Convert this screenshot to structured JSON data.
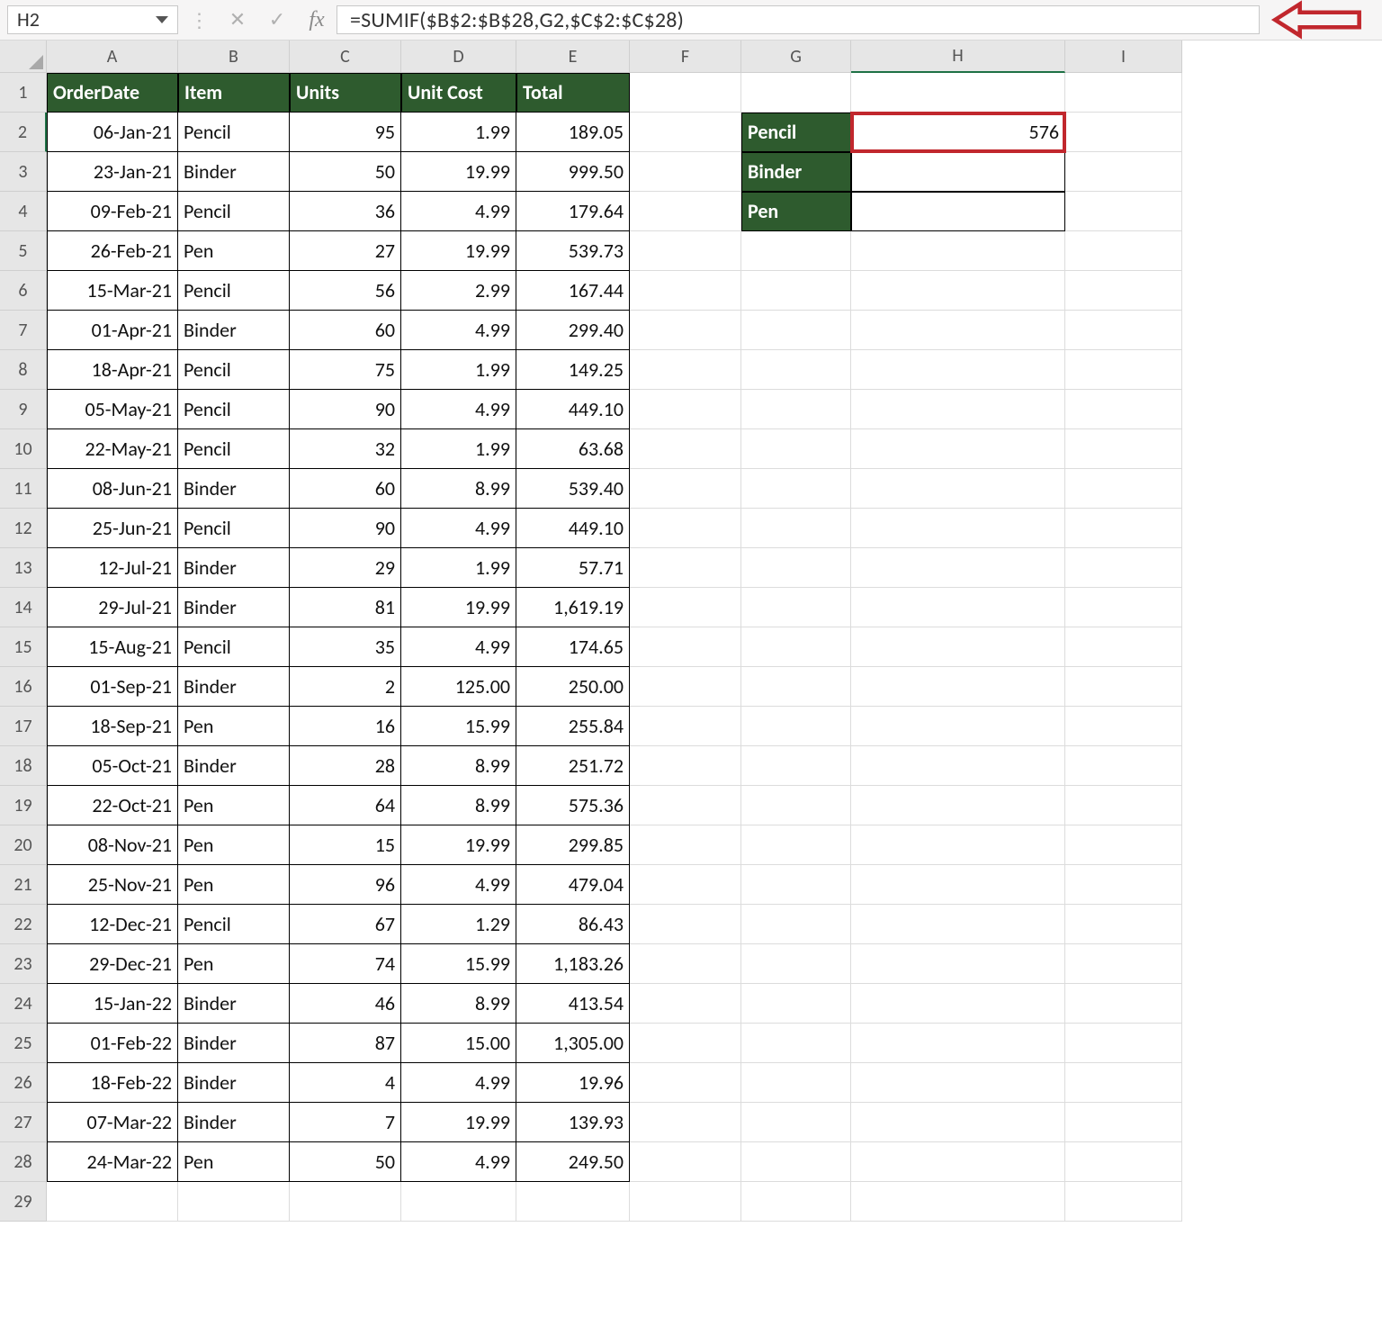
{
  "namebox": "H2",
  "formula": "=SUMIF($B$2:$B$28,G2,$C$2:$C$28)",
  "fx_label": "fx",
  "col_labels": [
    "A",
    "B",
    "C",
    "D",
    "E",
    "F",
    "G",
    "H",
    "I"
  ],
  "row_labels": [
    "1",
    "2",
    "3",
    "4",
    "5",
    "6",
    "7",
    "8",
    "9",
    "10",
    "11",
    "12",
    "13",
    "14",
    "15",
    "16",
    "17",
    "18",
    "19",
    "20",
    "21",
    "22",
    "23",
    "24",
    "25",
    "26",
    "27",
    "28",
    "29"
  ],
  "table": {
    "headers": [
      "OrderDate",
      "Item",
      "Units",
      "Unit Cost",
      "Total"
    ],
    "rows": [
      [
        "06-Jan-21",
        "Pencil",
        "95",
        "1.99",
        "189.05"
      ],
      [
        "23-Jan-21",
        "Binder",
        "50",
        "19.99",
        "999.50"
      ],
      [
        "09-Feb-21",
        "Pencil",
        "36",
        "4.99",
        "179.64"
      ],
      [
        "26-Feb-21",
        "Pen",
        "27",
        "19.99",
        "539.73"
      ],
      [
        "15-Mar-21",
        "Pencil",
        "56",
        "2.99",
        "167.44"
      ],
      [
        "01-Apr-21",
        "Binder",
        "60",
        "4.99",
        "299.40"
      ],
      [
        "18-Apr-21",
        "Pencil",
        "75",
        "1.99",
        "149.25"
      ],
      [
        "05-May-21",
        "Pencil",
        "90",
        "4.99",
        "449.10"
      ],
      [
        "22-May-21",
        "Pencil",
        "32",
        "1.99",
        "63.68"
      ],
      [
        "08-Jun-21",
        "Binder",
        "60",
        "8.99",
        "539.40"
      ],
      [
        "25-Jun-21",
        "Pencil",
        "90",
        "4.99",
        "449.10"
      ],
      [
        "12-Jul-21",
        "Binder",
        "29",
        "1.99",
        "57.71"
      ],
      [
        "29-Jul-21",
        "Binder",
        "81",
        "19.99",
        "1,619.19"
      ],
      [
        "15-Aug-21",
        "Pencil",
        "35",
        "4.99",
        "174.65"
      ],
      [
        "01-Sep-21",
        "Binder",
        "2",
        "125.00",
        "250.00"
      ],
      [
        "18-Sep-21",
        "Pen",
        "16",
        "15.99",
        "255.84"
      ],
      [
        "05-Oct-21",
        "Binder",
        "28",
        "8.99",
        "251.72"
      ],
      [
        "22-Oct-21",
        "Pen",
        "64",
        "8.99",
        "575.36"
      ],
      [
        "08-Nov-21",
        "Pen",
        "15",
        "19.99",
        "299.85"
      ],
      [
        "25-Nov-21",
        "Pen",
        "96",
        "4.99",
        "479.04"
      ],
      [
        "12-Dec-21",
        "Pencil",
        "67",
        "1.29",
        "86.43"
      ],
      [
        "29-Dec-21",
        "Pen",
        "74",
        "15.99",
        "1,183.26"
      ],
      [
        "15-Jan-22",
        "Binder",
        "46",
        "8.99",
        "413.54"
      ],
      [
        "01-Feb-22",
        "Binder",
        "87",
        "15.00",
        "1,305.00"
      ],
      [
        "18-Feb-22",
        "Binder",
        "4",
        "4.99",
        "19.96"
      ],
      [
        "07-Mar-22",
        "Binder",
        "7",
        "19.99",
        "139.93"
      ],
      [
        "24-Mar-22",
        "Pen",
        "50",
        "4.99",
        "249.50"
      ]
    ]
  },
  "summary": {
    "items": [
      "Pencil",
      "Binder",
      "Pen"
    ],
    "values": [
      "576",
      "",
      ""
    ]
  }
}
